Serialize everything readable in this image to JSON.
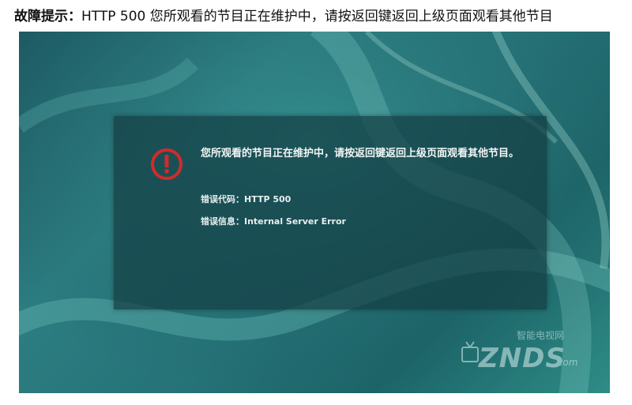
{
  "caption": {
    "label": "故障提示：",
    "text": "HTTP 500 您所观看的节目正在维护中，请按返回键返回上级页面观看其他节目"
  },
  "dialog": {
    "message": "您所观看的节目正在维护中，请按返回键返回上级页面观看其他节目。",
    "error_code_label": "错误代码：",
    "error_code": "HTTP 500",
    "error_info_label": "错误信息：",
    "error_info": "Internal Server Error",
    "icon": "error-power-icon"
  },
  "watermark": {
    "site_name": "智能电视网",
    "brand": "ZNDS",
    "suffix": ".com"
  },
  "colors": {
    "icon_red": "#d42a2a",
    "screen_teal": "#2c7e82"
  }
}
